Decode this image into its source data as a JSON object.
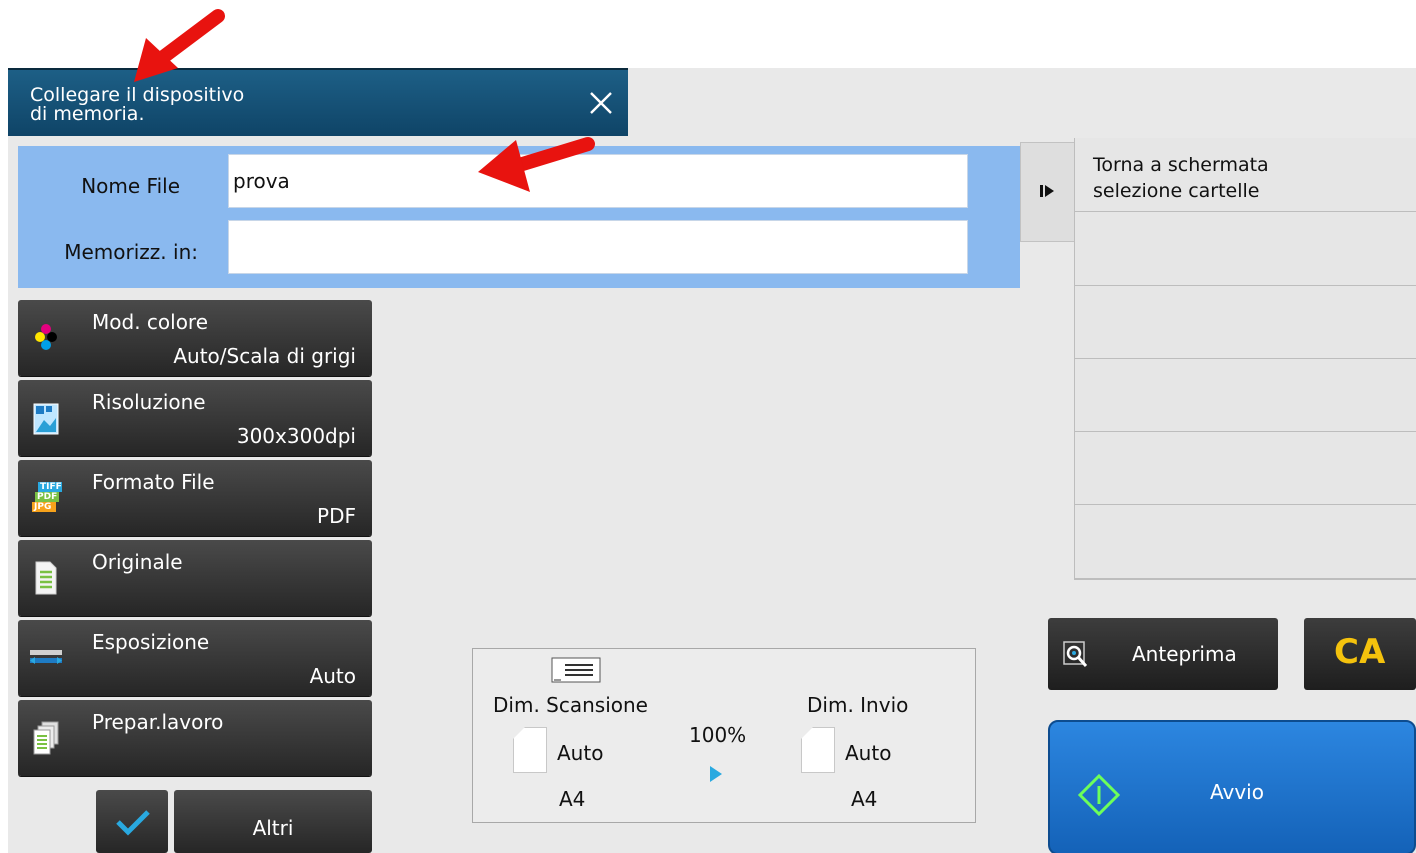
{
  "notification": {
    "message_line1": "Collegare il dispositivo",
    "message_line2": "di memoria."
  },
  "filename": {
    "name_label": "Nome File",
    "name_value": "prova",
    "store_label": "Memorizz. in:",
    "store_value": ""
  },
  "functions": [
    {
      "title": "Mod. colore",
      "value": "Auto/Scala di grigi",
      "icon": "color-mode-icon"
    },
    {
      "title": "Risoluzione",
      "value": "300x300dpi",
      "icon": "resolution-icon"
    },
    {
      "title": "Formato File",
      "value": "PDF",
      "icon": "file-format-icon"
    },
    {
      "title": "Originale",
      "value": "",
      "icon": "original-icon"
    },
    {
      "title": "Esposizione",
      "value": "Auto",
      "icon": "exposure-icon"
    },
    {
      "title": "Prepar.lavoro",
      "value": "",
      "icon": "job-build-icon"
    }
  ],
  "format_icon_text": {
    "tiff": "TIFF",
    "pdf": "PDF",
    "jpg": "JPG"
  },
  "bottom": {
    "altri_label": "Altri"
  },
  "size_info": {
    "scan_label": "Dim. Scansione",
    "scan_value": "Auto",
    "scan_paper": "A4",
    "ratio": "100%",
    "send_label": "Dim. Invio",
    "send_value": "Auto",
    "send_paper": "A4"
  },
  "right_panel": {
    "return_line1": "Torna a schermata",
    "return_line2": "selezione cartelle"
  },
  "actions": {
    "preview_label": "Anteprima",
    "ca_label": "CA",
    "start_label": "Avvio"
  },
  "colors": {
    "notice_bg": "#164f76",
    "file_panel_bg": "#8ab9ef",
    "start_bg": "#1f74cf",
    "ca_text": "#f4c20d",
    "annotation_arrow": "#e8130f"
  }
}
